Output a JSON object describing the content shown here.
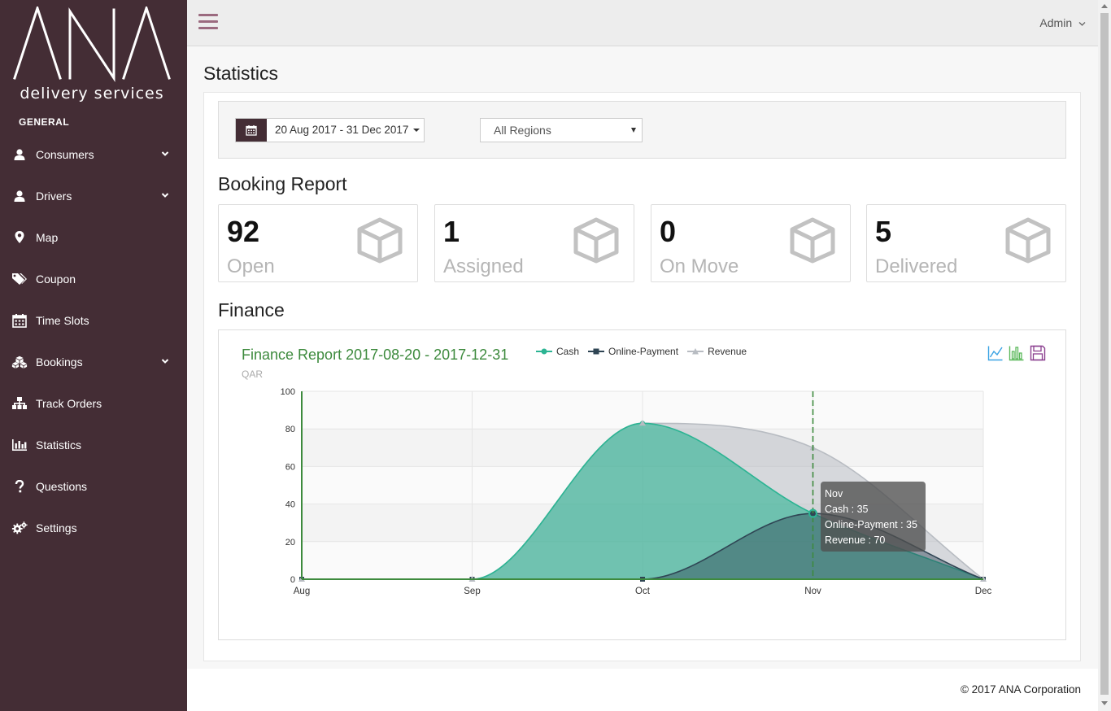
{
  "brand": {
    "logo_text": "ANA",
    "tagline": "delivery services"
  },
  "sidebar": {
    "section_title": "GENERAL",
    "items": [
      {
        "label": "Consumers",
        "icon": "user-icon",
        "has_submenu": true
      },
      {
        "label": "Drivers",
        "icon": "user-icon",
        "has_submenu": true
      },
      {
        "label": "Map",
        "icon": "map-marker-icon",
        "has_submenu": false
      },
      {
        "label": "Coupon",
        "icon": "tags-icon",
        "has_submenu": false
      },
      {
        "label": "Time Slots",
        "icon": "calendar-icon",
        "has_submenu": false
      },
      {
        "label": "Bookings",
        "icon": "cubes-icon",
        "has_submenu": true
      },
      {
        "label": "Track Orders",
        "icon": "sitemap-icon",
        "has_submenu": false
      },
      {
        "label": "Statistics",
        "icon": "bar-chart-icon",
        "has_submenu": false
      },
      {
        "label": "Questions",
        "icon": "question-icon",
        "has_submenu": false
      },
      {
        "label": "Settings",
        "icon": "gears-icon",
        "has_submenu": false
      }
    ]
  },
  "header": {
    "user": "Admin"
  },
  "page": {
    "title": "Statistics"
  },
  "filters": {
    "date_range": "20 Aug 2017 - 31 Dec 2017",
    "region": "All Regions"
  },
  "booking_report": {
    "title": "Booking Report",
    "cards": [
      {
        "value": "92",
        "label": "Open"
      },
      {
        "value": "1",
        "label": "Assigned"
      },
      {
        "value": "0",
        "label": "On Move"
      },
      {
        "value": "5",
        "label": "Delivered"
      }
    ]
  },
  "finance": {
    "title": "Finance"
  },
  "chart_data": {
    "type": "area",
    "title": "Finance Report 2017-08-20 - 2017-12-31",
    "ylabel": "QAR",
    "xlabel": "",
    "categories": [
      "Aug",
      "Sep",
      "Oct",
      "Nov",
      "Dec"
    ],
    "ylim": [
      0,
      100
    ],
    "yticks": [
      0,
      20,
      40,
      60,
      80,
      100
    ],
    "series": [
      {
        "name": "Cash",
        "values": [
          0,
          0,
          83,
          35,
          0
        ],
        "color": "#2cb493",
        "marker": "circle"
      },
      {
        "name": "Online-Payment",
        "values": [
          0,
          0,
          0,
          35,
          0
        ],
        "color": "#2f4554",
        "marker": "square"
      },
      {
        "name": "Revenue",
        "values": [
          0,
          0,
          83,
          70,
          0
        ],
        "color": "#b8bcc2",
        "marker": "triangle"
      }
    ],
    "legend_position": "top",
    "tooltip": {
      "category": "Nov",
      "lines": [
        "Cash : 35",
        "Online-Payment : 35",
        "Revenue : 70"
      ]
    }
  },
  "footer": {
    "text": "© 2017 ANA Corporation"
  }
}
